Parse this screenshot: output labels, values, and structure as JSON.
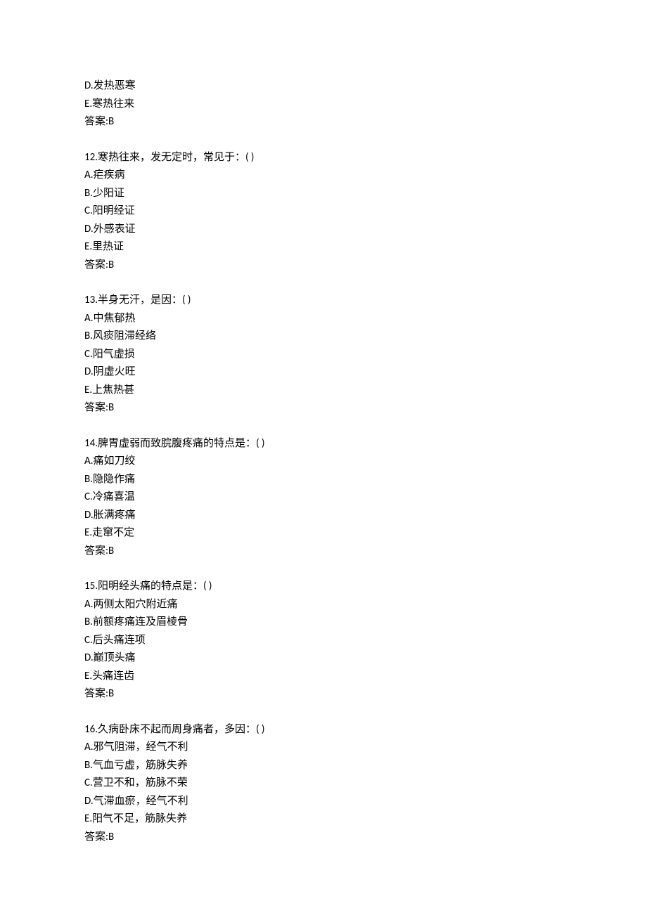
{
  "orphan_options": {
    "d": "D.发热恶寒",
    "e": "E.寒热往来",
    "answer": "答案:B"
  },
  "questions": [
    {
      "stem": "12.寒热往来，发无定时，常见于：( )",
      "options": [
        "A.疟疾病",
        "B.少阳证",
        "C.阳明经证",
        "D.外感表证",
        "E.里热证"
      ],
      "answer": "答案:B"
    },
    {
      "stem": "13.半身无汗，是因：( )",
      "options": [
        "A.中焦郁热",
        "B.风痰阻滞经络",
        "C.阳气虚损",
        "D.阴虚火旺",
        "E.上焦热甚"
      ],
      "answer": "答案:B"
    },
    {
      "stem": "14.脾胃虚弱而致脘腹疼痛的特点是：( )",
      "options": [
        "A.痛如刀绞",
        "B.隐隐作痛",
        "C.冷痛喜温",
        "D.胀满疼痛",
        "E.走窜不定"
      ],
      "answer": "答案:B"
    },
    {
      "stem": "15.阳明经头痛的特点是：( )",
      "options": [
        "A.两侧太阳穴附近痛",
        "B.前额疼痛连及眉棱骨",
        "C.后头痛连项",
        "D.巅顶头痛",
        "E.头痛连齿"
      ],
      "answer": "答案:B"
    },
    {
      "stem": "16.久病卧床不起而周身痛者，多因：( )",
      "options": [
        "A.邪气阻滞，经气不利",
        "B.气血亏虚，筋脉失养",
        "C.营卫不和，筋脉不荣",
        "D.气滞血瘀，经气不利",
        "E.阳气不足，筋脉失养"
      ],
      "answer": "答案:B"
    }
  ]
}
